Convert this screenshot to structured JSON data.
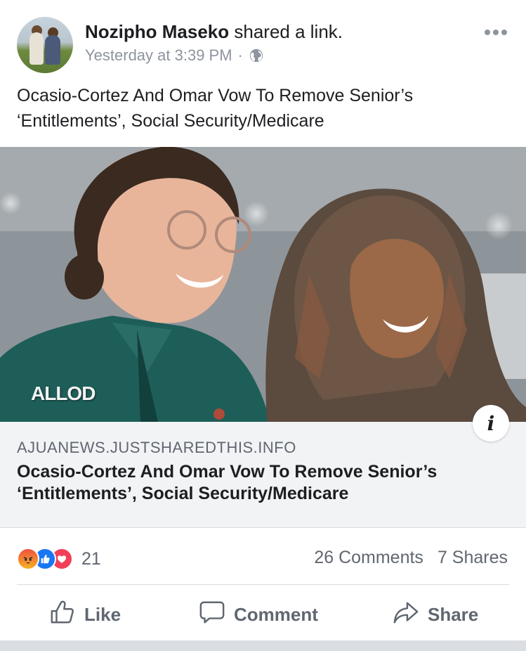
{
  "post": {
    "author": "Nozipho Maseko",
    "action_text": "shared a link.",
    "timestamp": "Yesterday at 3:39 PM",
    "separator": "·",
    "privacy_icon": "globe-icon",
    "more_icon": "more-options-icon",
    "text_line1": "Ocasio-Cortez And Omar Vow To Remove Senior’s",
    "text_line2": "‘Entitlements’, Social Security/Medicare"
  },
  "link": {
    "watermark": "ALLOD",
    "domain": "AJUANEWS.JUSTSHAREDTHIS.INFO",
    "title_line1": "Ocasio-Cortez And Omar Vow To Remove Senior’s",
    "title_line2": "‘Entitlements’, Social Security/Medicare",
    "info_icon": "i"
  },
  "stats": {
    "reactions": [
      "angry-icon",
      "like-icon",
      "love-icon"
    ],
    "reaction_count": "21",
    "comments": "26 Comments",
    "shares": "7 Shares"
  },
  "actions": {
    "like": "Like",
    "comment": "Comment",
    "share": "Share"
  },
  "colors": {
    "brand_blue": "#1877f2",
    "text_primary": "#1c1e21",
    "text_secondary": "#606770",
    "link_bg": "#f2f3f5"
  }
}
